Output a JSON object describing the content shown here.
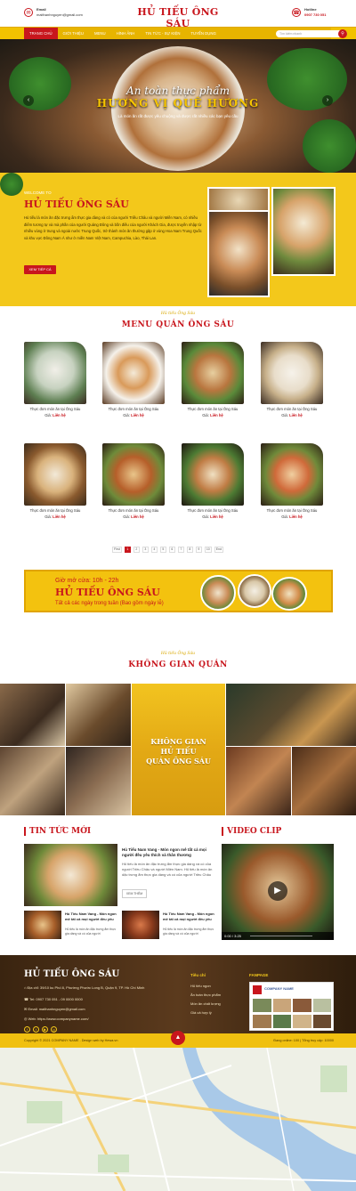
{
  "header": {
    "email_label": "Email",
    "email_value": "maithanhnguyen@gmail.com",
    "logo": "HỦ TIẾU ÔNG SÁU",
    "hotline_label": "Hotline",
    "hotline_value": "0907 730 051"
  },
  "nav": {
    "items": [
      "TRANG CHỦ",
      "GIỚI THIỆU",
      "MENU",
      "HÌNH ẢNH",
      "TIN TỨC - SỰ KIỆN",
      "TUYỂN DỤNG"
    ],
    "search_placeholder": "Tìm kiếm nhanh"
  },
  "hero": {
    "line1": "An toàn thực phẩm",
    "line2": "HƯƠNG VỊ QUÊ HƯƠNG",
    "line3": "Là món ăn rất được yêu chuộng và được rất nhiều các bạn yêu cầu"
  },
  "about": {
    "welcome": "WELCOME TO",
    "title": "HỦ TIẾU ÔNG SÁU",
    "desc": "Hủ tiếu là món ăn đặc trưng ẩm thực gia dàng và có của người Triều Châu và người Miền Nam, có nhiều điểm tương tự và mà phần của người Quảng Đông và bồn điều của người Khách Gia, được truyền nhập từ nhiều vùng ở trung và ngoài nước Trung Quốc, trở thành món ăn thường gặp ở vùng Hoa Nam Trung Quốc và khu vực Đông Nam Á như ở miền Nam Việt Nam, Campuchia, Lào, Thái Lan.",
    "button": "XEM TIẾP CÁ"
  },
  "menu_section": {
    "subtitle": "Hủ tiếu Ông Sáu",
    "title": "MENU QUÁN ÔNG SÁU",
    "price_label": "Giá:",
    "price_value": "Liên hệ",
    "items": [
      "Thực đơn món ăn tại Ông Sáu",
      "Thực đơn món ăn tại Ông Sáu",
      "Thực đơn món ăn tại Ông Sáu",
      "Thực đơn món ăn tại Ông Sáu",
      "Thực đơn món ăn tại Ông Sáu",
      "Thực đơn món ăn tại Ông Sáu",
      "Thực đơn món ăn tại Ông Sáu",
      "Thực đơn món ăn tại Ông Sáu"
    ],
    "pagination": [
      "First",
      "1",
      "2",
      "3",
      "4",
      "5",
      "6",
      "7",
      "8",
      "9",
      "10",
      "End"
    ]
  },
  "banner": {
    "hours": "Giờ mở cửa: 10h - 22h",
    "title": "HỦ TIẾU ÔNG SÁU",
    "note": "Tất cả các ngày trong tuần (Bao gồm ngày lễ)"
  },
  "space_section": {
    "subtitle": "Hủ tiếu Ông Sáu",
    "title": "KHÔNG GIAN QUÁN",
    "overlay": [
      "KHÔNG GIAN",
      "HỦ TIẾU",
      "QUÁN ÔNG SÁU"
    ]
  },
  "news": {
    "title": "TIN TỨC MỚI",
    "main_headline": "Hủ Tiếu Nam Vang - Món ngon mê tất cả mọi người đều yêu thích và thân thương",
    "main_text": "Hủ tiếu là món ăn đặc trưng ẩm thực gia dàng và có của người Triều Châu và người Miền Nam. Hủ tiếu là món ăn dặc trưng ẩm thực gia dàng và có của người Triều Châu",
    "more": "XEM THÊM",
    "small": [
      {
        "headline": "Hủ Tiếu Nam Vang - Món ngon mê tất cả mọi người đều yêu",
        "text": "Hủ tiếu là món ăn đặc trưng ẩm thực gia dàng và có của người"
      },
      {
        "headline": "Hủ Tiếu Nam Vang - Món ngon mê tất cả mọi người đều yêu",
        "text": "Hủ tiếu là món ăn đặc trưng ẩm thực gia dàng và có của người"
      }
    ]
  },
  "video": {
    "title": "VIDEO CLIP",
    "time": "0:00 / 3:25"
  },
  "footer": {
    "title": "HỦ TIẾU ÔNG SÁU",
    "address": "Địa chỉ: 39/10 ku Phố 8, Phường Phước Long B, Quận 9, TP. Hồ Chí Minh",
    "phone": "Tel: 0907 730 051 - 09 0000 0000",
    "email": "Email: maithanhnguyen@gmail.com",
    "website": "Web: https://www.companyname.com/",
    "links_title": "Tiêu chí",
    "links": [
      "Hủ tiếu ngon",
      "Ăn toàn thực phẩm",
      "Món ăn chất lượng",
      "Giá cả hợp lý"
    ],
    "fanpage_title": "FANPAGE",
    "fanpage_name": "COMPANY NAME"
  },
  "copyright": {
    "left": "Copyright © 2021 COMPANY NAME . Design web by Hewa.vn",
    "right": "Đang online: 100 | Tổng truy cập: 10000"
  },
  "colors": {
    "brand_red": "#c8161d",
    "brand_yellow": "#f3c81b"
  }
}
